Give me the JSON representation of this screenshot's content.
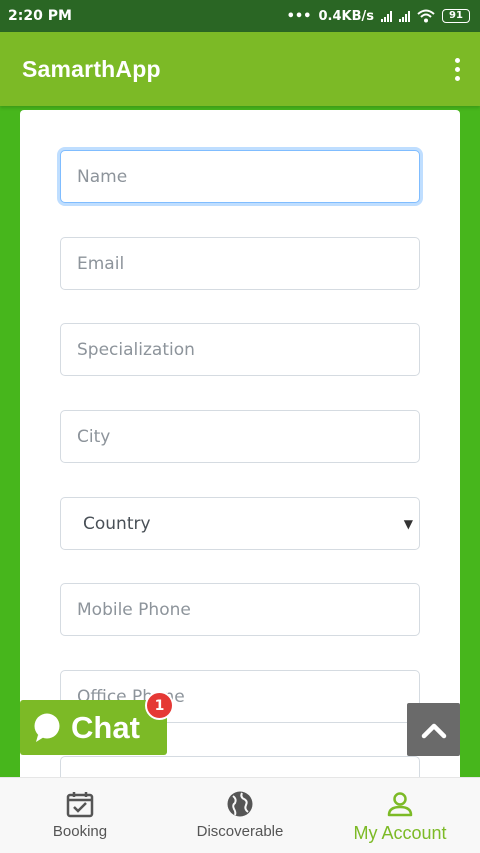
{
  "status_bar": {
    "time": "2:20 PM",
    "dots": "•••",
    "speed": "0.4KB/s",
    "battery": "91"
  },
  "app_bar": {
    "title": "SamarthApp"
  },
  "form": {
    "name_placeholder": "Name",
    "email_placeholder": "Email",
    "specialization_placeholder": "Specialization",
    "city_placeholder": "City",
    "country_label": "Country",
    "mobile_placeholder": "Mobile Phone",
    "office_placeholder": "Office Phone"
  },
  "chat": {
    "label": "Chat",
    "badge": "1"
  },
  "bottom_nav": {
    "items": [
      {
        "label": "Booking",
        "icon": "calendar-check-icon"
      },
      {
        "label": "Discoverable",
        "icon": "globe-icon"
      },
      {
        "label": "My Account",
        "icon": "person-icon"
      }
    ],
    "active": "My Account"
  },
  "colors": {
    "status_bar": "#2a6624",
    "app_bar": "#7cba26",
    "background": "#47b61c",
    "accent": "#7cba26",
    "badge": "#e53935"
  }
}
